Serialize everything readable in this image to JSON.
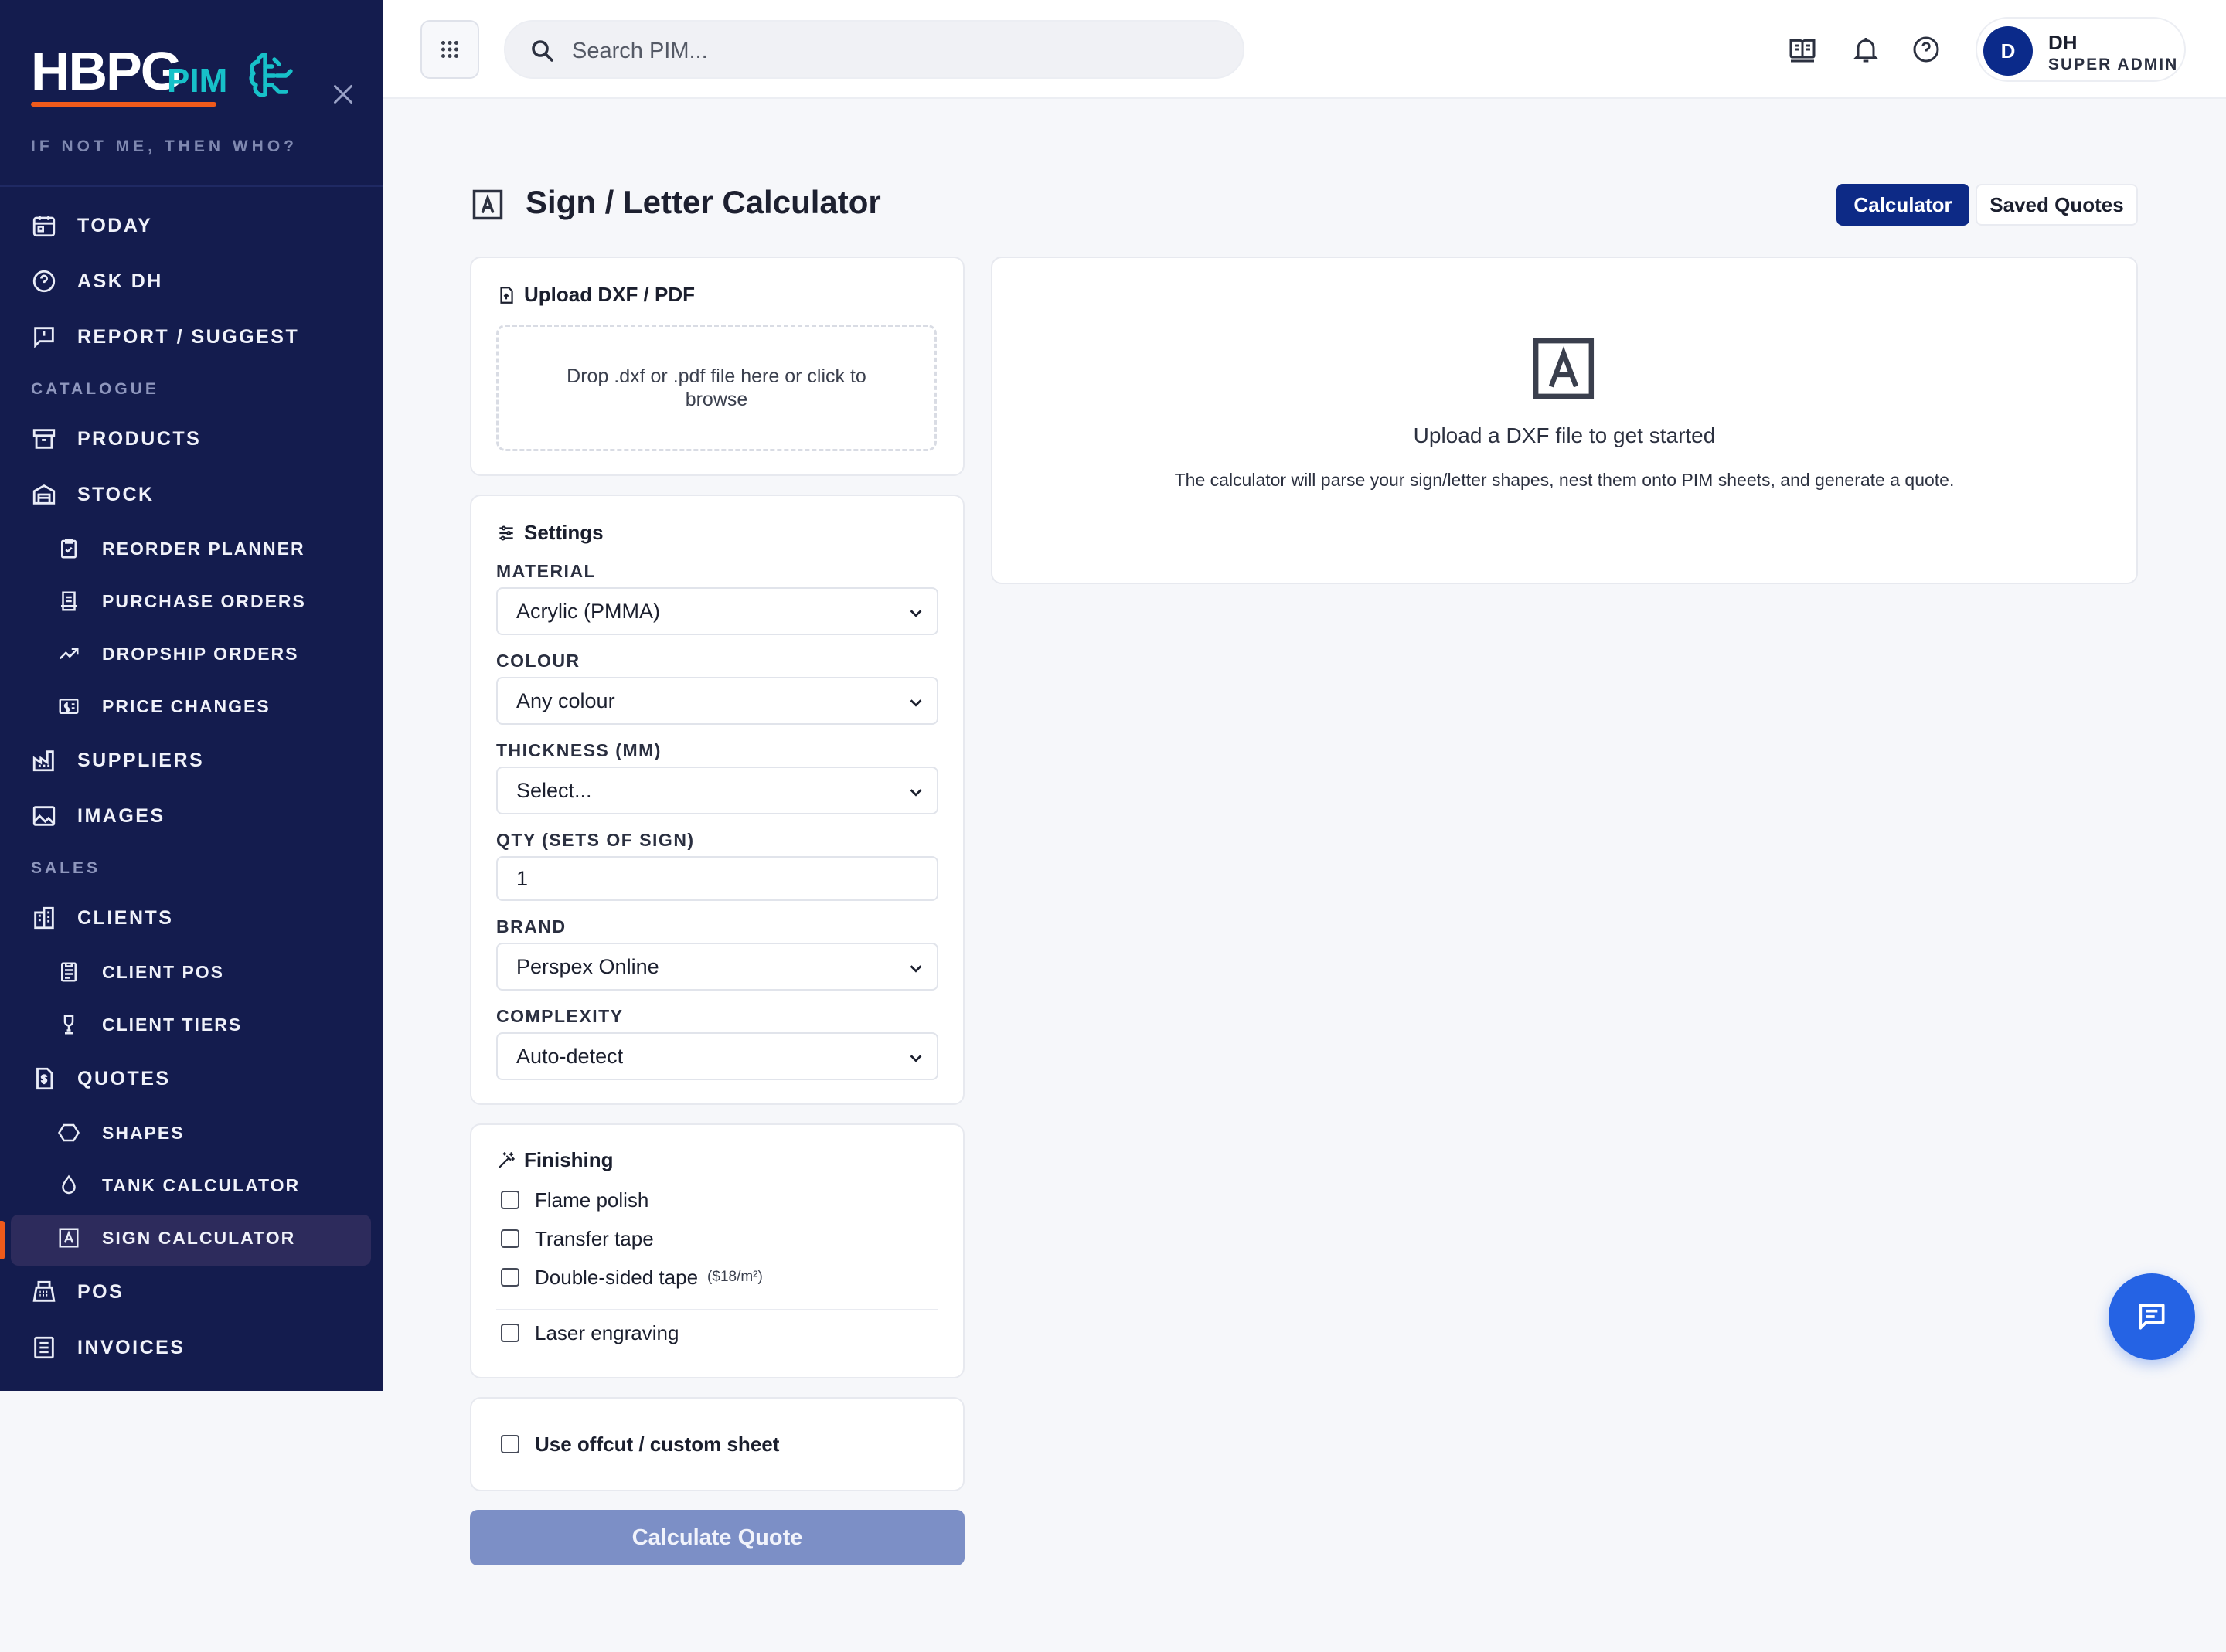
{
  "brand": {
    "logo_main": "HBPG",
    "logo_sub": "PIM",
    "tagline": "IF NOT ME, THEN WHO?"
  },
  "sidebar": {
    "items": [
      {
        "label": "TODAY",
        "icon": "calendar-icon"
      },
      {
        "label": "ASK DH",
        "icon": "question-circle-icon"
      },
      {
        "label": "REPORT / SUGGEST",
        "icon": "feedback-icon"
      },
      {
        "section": "CATALOGUE"
      },
      {
        "label": "PRODUCTS",
        "icon": "archive-box-icon"
      },
      {
        "label": "STOCK",
        "icon": "warehouse-icon"
      },
      {
        "label": "REORDER PLANNER",
        "icon": "clipboard-check-icon",
        "sub": true
      },
      {
        "label": "PURCHASE ORDERS",
        "icon": "receipt-icon",
        "sub": true
      },
      {
        "label": "DROPSHIP ORDERS",
        "icon": "trend-up-icon",
        "sub": true
      },
      {
        "label": "PRICE CHANGES",
        "icon": "price-tag-icon",
        "sub": true
      },
      {
        "label": "SUPPLIERS",
        "icon": "factory-icon"
      },
      {
        "label": "IMAGES",
        "icon": "image-icon"
      },
      {
        "section": "SALES"
      },
      {
        "label": "CLIENTS",
        "icon": "buildings-icon"
      },
      {
        "label": "CLIENT POS",
        "icon": "document-list-icon",
        "sub": true
      },
      {
        "label": "CLIENT TIERS",
        "icon": "trophy-icon",
        "sub": true
      },
      {
        "label": "QUOTES",
        "icon": "dollar-document-icon"
      },
      {
        "label": "SHAPES",
        "icon": "hexagon-icon",
        "sub": true
      },
      {
        "label": "TANK CALCULATOR",
        "icon": "droplet-icon",
        "sub": true
      },
      {
        "label": "SIGN CALCULATOR",
        "icon": "letter-a-icon",
        "sub": true,
        "active": true
      },
      {
        "label": "POS",
        "icon": "cash-register-icon"
      },
      {
        "label": "INVOICES",
        "icon": "invoice-icon"
      }
    ]
  },
  "topbar": {
    "search_placeholder": "Search PIM...",
    "user": {
      "initial": "D",
      "name": "DH",
      "role": "SUPER ADMIN"
    }
  },
  "page": {
    "title": "Sign / Letter Calculator",
    "tabs": {
      "calculator": "Calculator",
      "saved_quotes": "Saved Quotes"
    }
  },
  "upload": {
    "title": "Upload DXF / PDF",
    "dropzone_text": "Drop .dxf or .pdf file here or click to browse"
  },
  "settings": {
    "title": "Settings",
    "material": {
      "label": "MATERIAL",
      "value": "Acrylic (PMMA)"
    },
    "colour": {
      "label": "COLOUR",
      "value": "Any colour"
    },
    "thickness": {
      "label": "THICKNESS (MM)",
      "value": "Select..."
    },
    "qty": {
      "label": "QTY (SETS OF SIGN)",
      "value": "1"
    },
    "brand": {
      "label": "BRAND",
      "value": "Perspex Online"
    },
    "complexity": {
      "label": "COMPLEXITY",
      "value": "Auto-detect"
    }
  },
  "finishing": {
    "title": "Finishing",
    "flame_polish": "Flame polish",
    "transfer_tape": "Transfer tape",
    "double_sided_tape": "Double-sided tape",
    "double_sided_tape_note": "($18/m²)",
    "laser_engraving": "Laser engraving"
  },
  "offcut": {
    "label": "Use offcut / custom sheet"
  },
  "actions": {
    "calculate": "Calculate Quote"
  },
  "empty_state": {
    "title": "Upload a DXF file to get started",
    "description": "The calculator will parse your sign/letter shapes, nest them onto PIM sheets, and generate a quote."
  },
  "colors": {
    "sidebar_bg": "#141c4e",
    "accent_orange": "#ef5a1b",
    "brand_teal": "#17c1c9",
    "primary_navy": "#0d2a86",
    "fab_blue": "#2563e4"
  }
}
